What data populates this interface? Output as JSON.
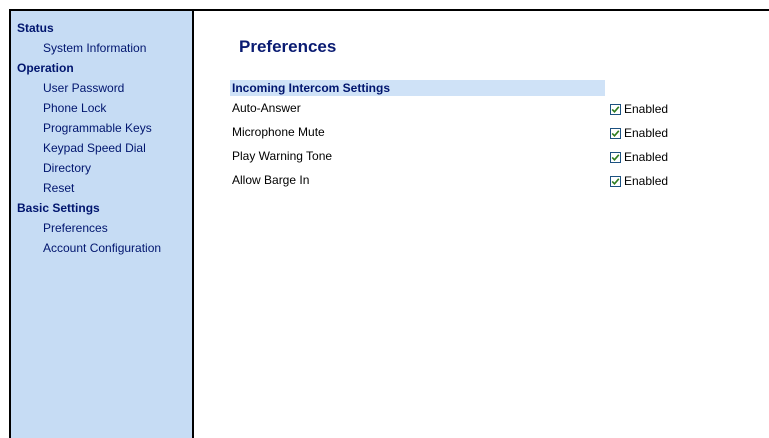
{
  "sidebar": {
    "sections": [
      {
        "title": "Status",
        "items": [
          {
            "label": "System Information"
          }
        ]
      },
      {
        "title": "Operation",
        "items": [
          {
            "label": "User Password"
          },
          {
            "label": "Phone Lock"
          },
          {
            "label": "Programmable Keys"
          },
          {
            "label": "Keypad Speed Dial"
          },
          {
            "label": "Directory"
          },
          {
            "label": "Reset"
          }
        ]
      },
      {
        "title": "Basic Settings",
        "items": [
          {
            "label": "Preferences"
          },
          {
            "label": "Account Configuration"
          }
        ]
      }
    ]
  },
  "main": {
    "title": "Preferences",
    "section": {
      "header": "Incoming Intercom Settings",
      "rows": [
        {
          "label": "Auto-Answer",
          "checked": true,
          "control_label": "Enabled"
        },
        {
          "label": "Microphone Mute",
          "checked": true,
          "control_label": "Enabled"
        },
        {
          "label": "Play Warning Tone",
          "checked": true,
          "control_label": "Enabled"
        },
        {
          "label": "Allow Barge In",
          "checked": true,
          "control_label": "Enabled"
        }
      ]
    }
  },
  "colors": {
    "sidebar_bg": "#c6dcf4",
    "nav_text": "#00156e",
    "section_header_bg": "#cfe2f7",
    "checkmark": "#2f7d1f"
  }
}
